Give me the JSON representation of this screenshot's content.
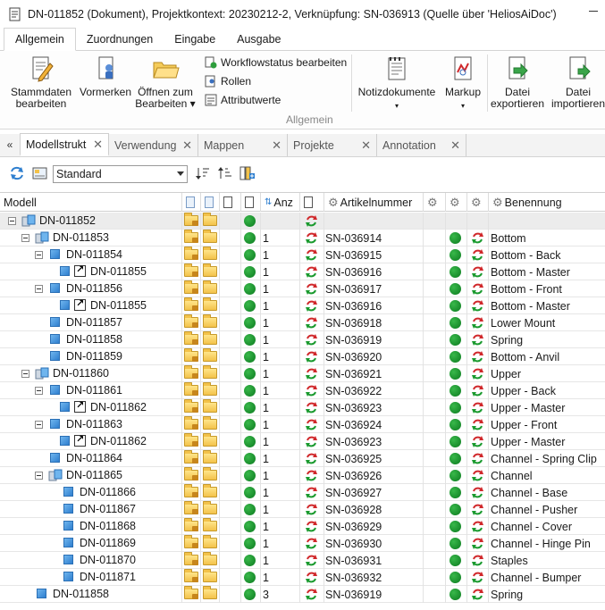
{
  "window": {
    "title": "DN-011852 (Dokument), Projektkontext: 20230212-2, Verknüpfung: SN-036913 (Quelle über 'HeliosAiDoc')"
  },
  "ribbon": {
    "tabs": [
      "Allgemein",
      "Zuordnungen",
      "Eingabe",
      "Ausgabe"
    ],
    "active_tab": "Allgemein",
    "buttons": {
      "stammdaten": "Stammdaten\nbearbeiten",
      "vormerken": "Vormerken",
      "oeffnen": "Öffnen zum\nBearbeiten ▾",
      "workflowstatus": "Workflowstatus bearbeiten",
      "rollen": "Rollen",
      "attributwerte": "Attributwerte",
      "notizdokumente": "Notizdokumente",
      "markup": "Markup",
      "exportieren": "Datei\nexportieren",
      "importieren": "Datei\nimportieren"
    },
    "group_label": "Allgemein"
  },
  "doc_tabs": [
    {
      "label": "Modellstrukt⁠",
      "active": true
    },
    {
      "label": "Verwendung",
      "active": false
    },
    {
      "label": "Mappen",
      "active": false
    },
    {
      "label": "Projekte",
      "active": false
    },
    {
      "label": "Annotation",
      "active": false
    }
  ],
  "toolbar": {
    "view_select": "Standard"
  },
  "grid": {
    "headers": {
      "modell": "Modell",
      "anz": "Anz",
      "artikelnummer": "Artikelnummer",
      "benennung": "Benennung"
    },
    "rows": [
      {
        "level": 0,
        "expand": true,
        "icon": "assembly",
        "name": "DN-011852",
        "anz": "",
        "artnr": "",
        "ben": "",
        "first": true
      },
      {
        "level": 1,
        "expand": true,
        "icon": "assembly",
        "name": "DN-011853",
        "anz": "1",
        "artnr": "SN-036914",
        "ben": "Bottom"
      },
      {
        "level": 2,
        "expand": true,
        "icon": "part",
        "name": "DN-011854",
        "anz": "1",
        "artnr": "SN-036915",
        "ben": "Bottom - Back"
      },
      {
        "level": 3,
        "expand": false,
        "icon": "link",
        "name": "DN-011855",
        "anz": "1",
        "artnr": "SN-036916",
        "ben": "Bottom - Master"
      },
      {
        "level": 2,
        "expand": true,
        "icon": "part",
        "name": "DN-011856",
        "anz": "1",
        "artnr": "SN-036917",
        "ben": "Bottom - Front"
      },
      {
        "level": 3,
        "expand": false,
        "icon": "link",
        "name": "DN-011855",
        "anz": "1",
        "artnr": "SN-036916",
        "ben": "Bottom - Master"
      },
      {
        "level": 2,
        "expand": false,
        "icon": "part",
        "name": "DN-011857",
        "anz": "1",
        "artnr": "SN-036918",
        "ben": "Lower Mount"
      },
      {
        "level": 2,
        "expand": false,
        "icon": "part",
        "name": "DN-011858",
        "anz": "1",
        "artnr": "SN-036919",
        "ben": "Spring"
      },
      {
        "level": 2,
        "expand": false,
        "icon": "part",
        "name": "DN-011859",
        "anz": "1",
        "artnr": "SN-036920",
        "ben": "Bottom - Anvil"
      },
      {
        "level": 1,
        "expand": true,
        "icon": "assembly",
        "name": "DN-011860",
        "anz": "1",
        "artnr": "SN-036921",
        "ben": "Upper"
      },
      {
        "level": 2,
        "expand": true,
        "icon": "part",
        "name": "DN-011861",
        "anz": "1",
        "artnr": "SN-036922",
        "ben": "Upper - Back"
      },
      {
        "level": 3,
        "expand": false,
        "icon": "link",
        "name": "DN-011862",
        "anz": "1",
        "artnr": "SN-036923",
        "ben": "Upper - Master"
      },
      {
        "level": 2,
        "expand": true,
        "icon": "part",
        "name": "DN-011863",
        "anz": "1",
        "artnr": "SN-036924",
        "ben": "Upper - Front"
      },
      {
        "level": 3,
        "expand": false,
        "icon": "link",
        "name": "DN-011862",
        "anz": "1",
        "artnr": "SN-036923",
        "ben": "Upper - Master"
      },
      {
        "level": 2,
        "expand": false,
        "icon": "part",
        "name": "DN-011864",
        "anz": "1",
        "artnr": "SN-036925",
        "ben": "Channel - Spring Clip"
      },
      {
        "level": 2,
        "expand": true,
        "icon": "assembly",
        "name": "DN-011865",
        "anz": "1",
        "artnr": "SN-036926",
        "ben": "Channel"
      },
      {
        "level": 3,
        "expand": false,
        "icon": "part",
        "name": "DN-011866",
        "anz": "1",
        "artnr": "SN-036927",
        "ben": "Channel - Base"
      },
      {
        "level": 3,
        "expand": false,
        "icon": "part",
        "name": "DN-011867",
        "anz": "1",
        "artnr": "SN-036928",
        "ben": "Channel - Pusher"
      },
      {
        "level": 3,
        "expand": false,
        "icon": "part",
        "name": "DN-011868",
        "anz": "1",
        "artnr": "SN-036929",
        "ben": "Channel - Cover"
      },
      {
        "level": 3,
        "expand": false,
        "icon": "part",
        "name": "DN-011869",
        "anz": "1",
        "artnr": "SN-036930",
        "ben": "Channel - Hinge Pin"
      },
      {
        "level": 3,
        "expand": false,
        "icon": "part",
        "name": "DN-011870",
        "anz": "1",
        "artnr": "SN-036931",
        "ben": "Staples"
      },
      {
        "level": 3,
        "expand": false,
        "icon": "part",
        "name": "DN-011871",
        "anz": "1",
        "artnr": "SN-036932",
        "ben": "Channel - Bumper"
      },
      {
        "level": 1,
        "expand": false,
        "icon": "part",
        "name": "DN-011858",
        "anz": "3",
        "artnr": "SN-036919",
        "ben": "Spring"
      }
    ]
  },
  "colors": {
    "status_green": "#1a9a2e",
    "accent_blue": "#2f7fcf",
    "folder_yellow": "#f3c24a"
  }
}
